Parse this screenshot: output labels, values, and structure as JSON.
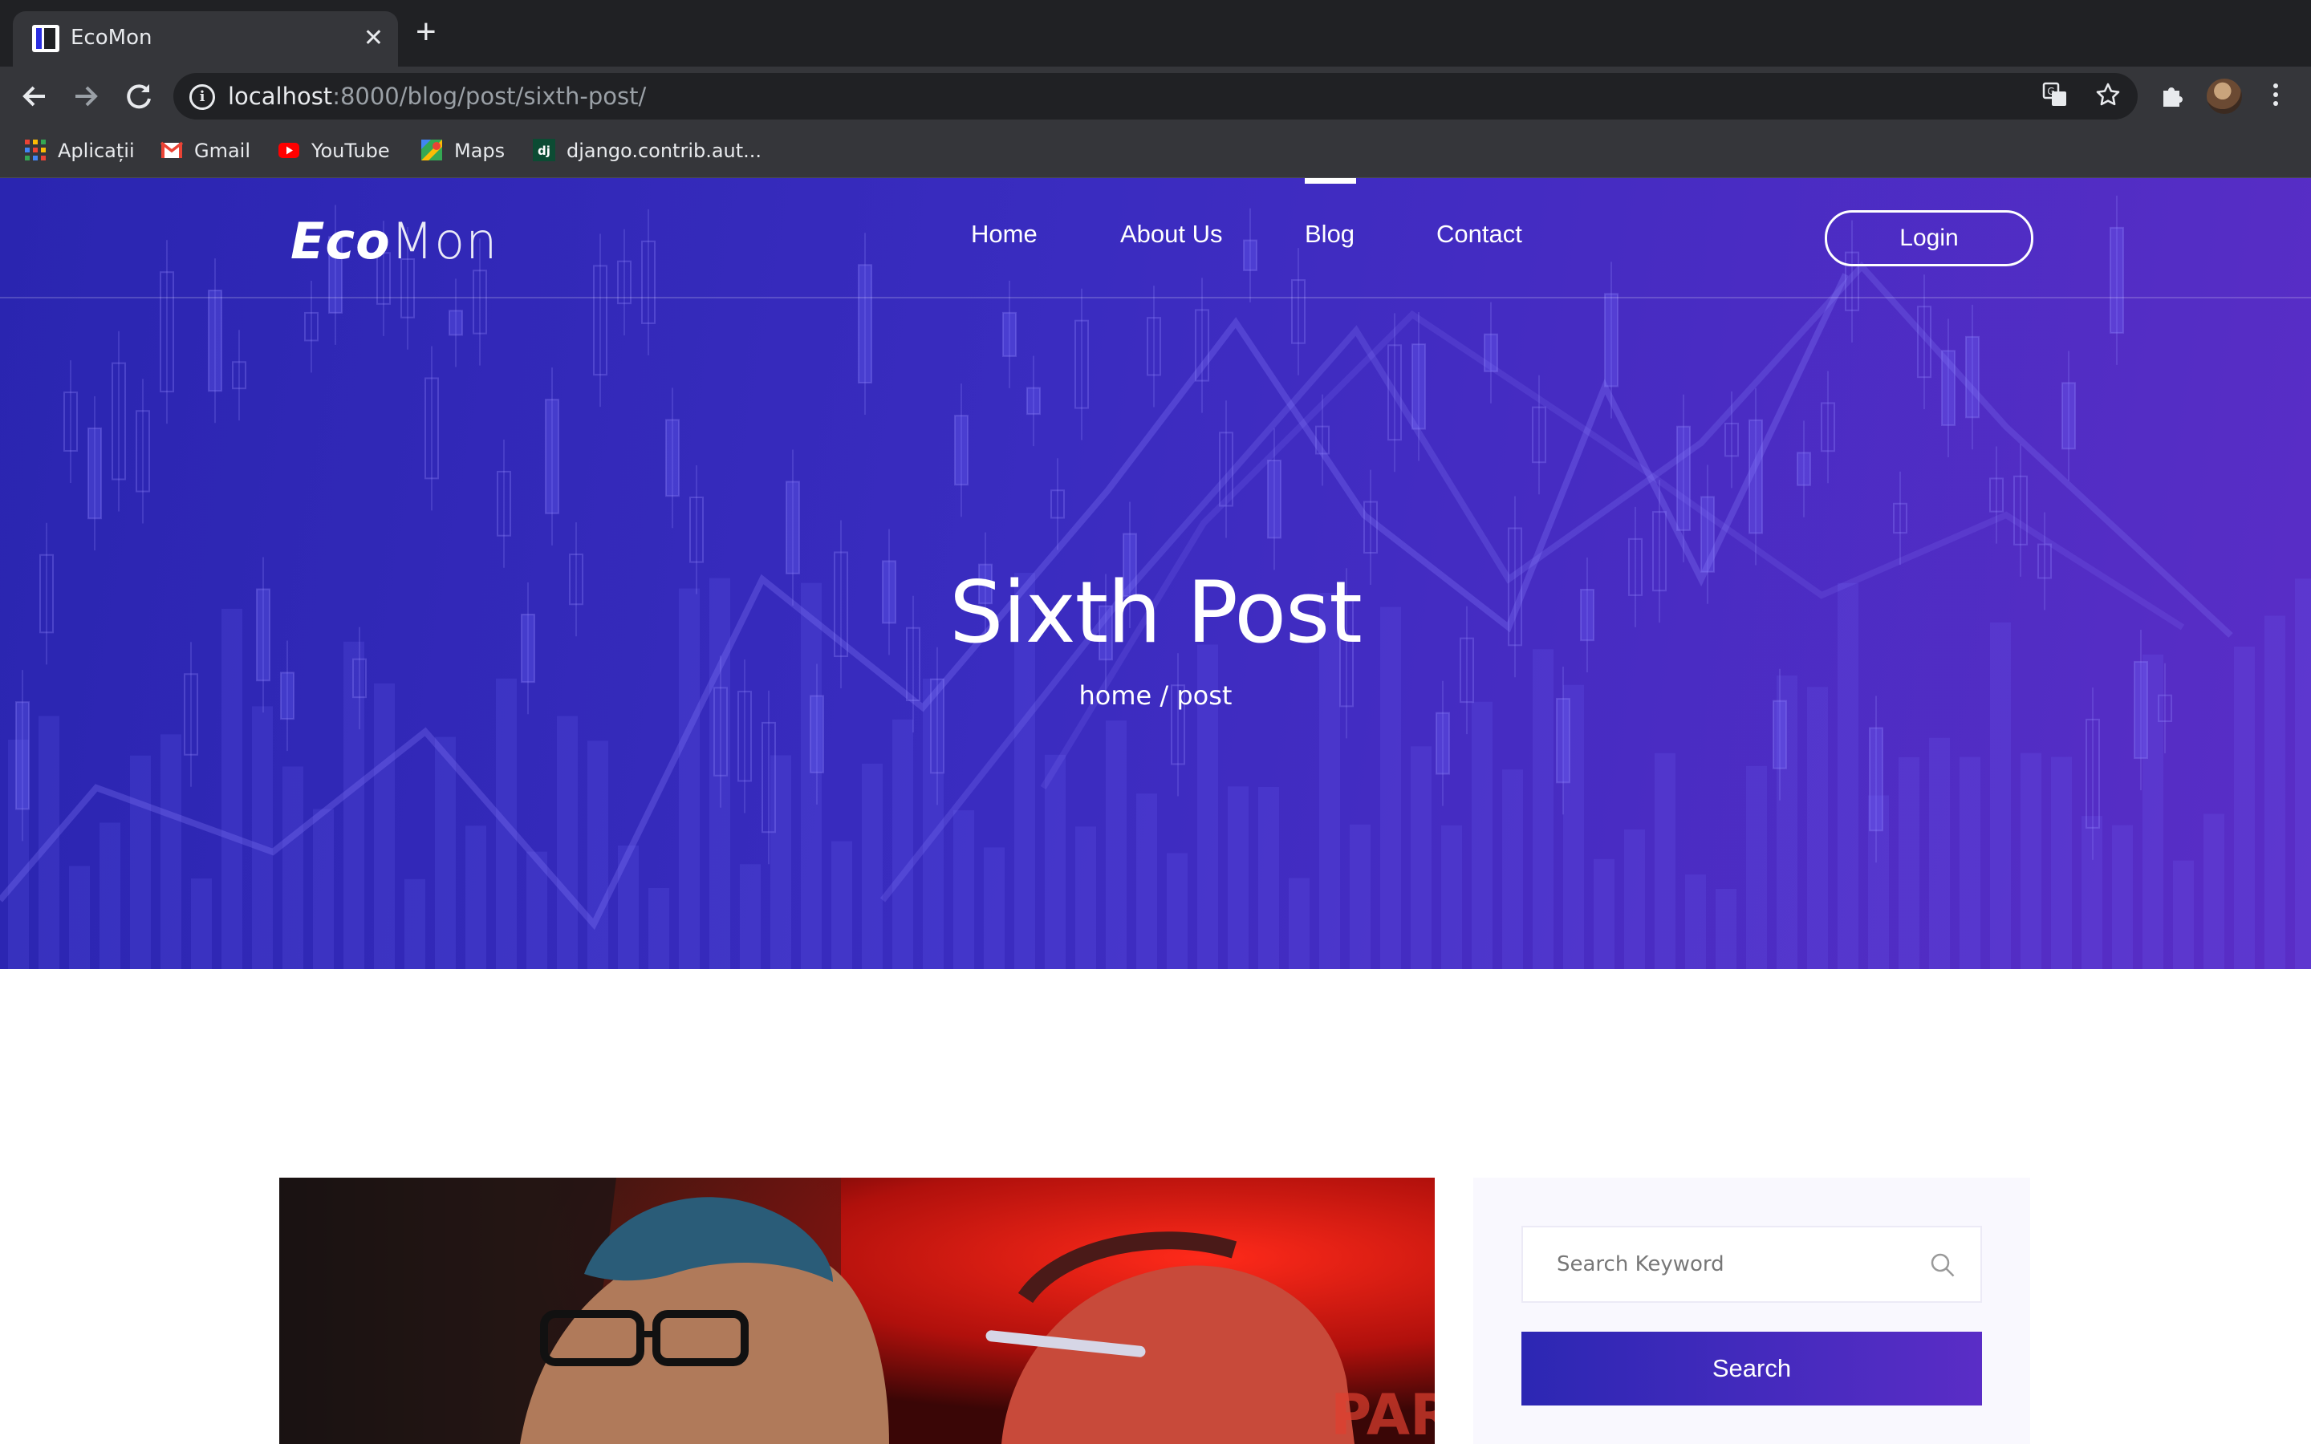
{
  "browser": {
    "tab_title": "EcoMon",
    "url_host": "localhost",
    "url_rest": ":8000/blog/post/sixth-post/",
    "bookmarks": [
      {
        "label": "Aplicații",
        "icon": "apps-grid-icon"
      },
      {
        "label": "Gmail",
        "icon": "gmail-icon"
      },
      {
        "label": "YouTube",
        "icon": "youtube-icon"
      },
      {
        "label": "Maps",
        "icon": "maps-icon"
      },
      {
        "label": "django.contrib.aut...",
        "icon": "django-icon"
      }
    ]
  },
  "site": {
    "logo_bold": "Eco",
    "logo_light": "Mon",
    "nav": [
      "Home",
      "About Us",
      "Blog",
      "Contact"
    ],
    "active_nav": "Blog",
    "login_label": "Login"
  },
  "hero": {
    "title": "Sixth Post",
    "breadcrumb": "home / post"
  },
  "sidebar": {
    "search_placeholder": "Search Keyword",
    "search_button": "Search"
  },
  "colors": {
    "hero_start": "#2a25b0",
    "hero_end": "#5a2dc6",
    "browser_dark": "#202124",
    "browser_toolbar": "#35363a"
  }
}
